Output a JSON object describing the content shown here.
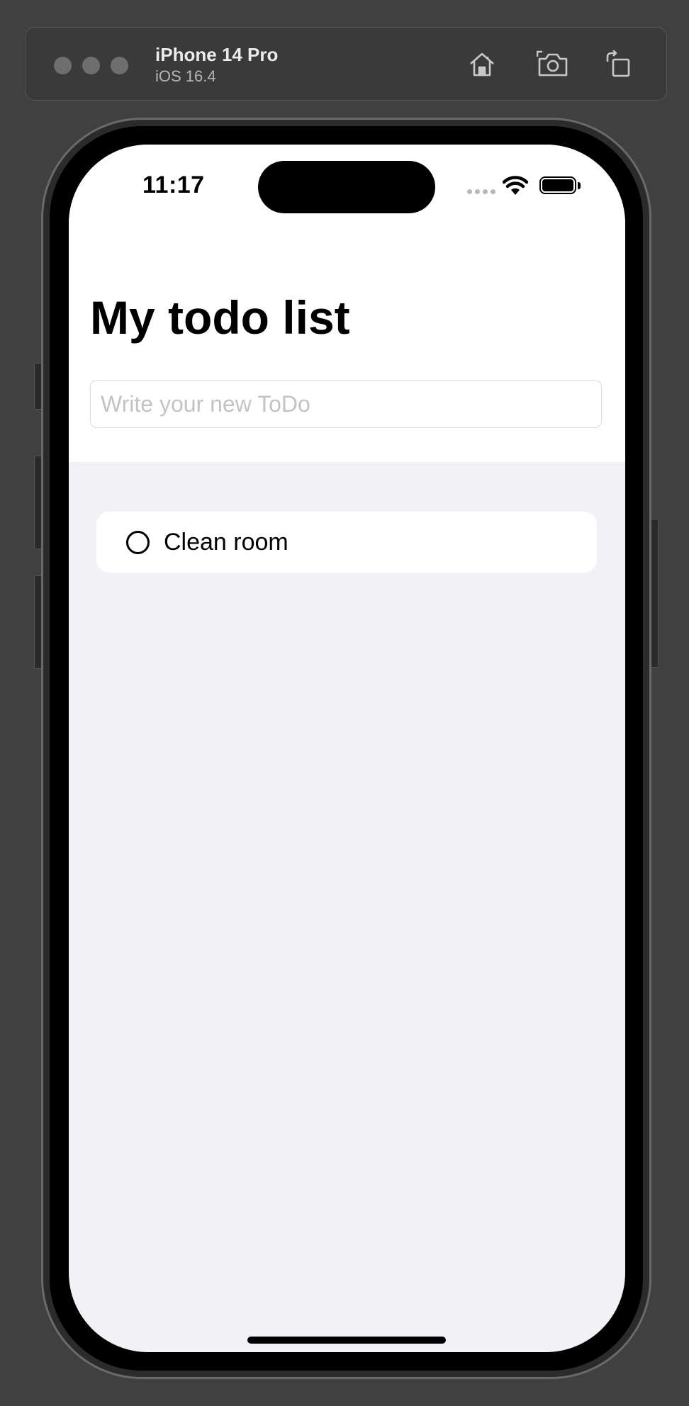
{
  "simulator": {
    "device_name": "iPhone 14 Pro",
    "os_version": "iOS 16.4",
    "toolbar_icons": [
      "home-icon",
      "screenshot-icon",
      "rotate-icon"
    ]
  },
  "status_bar": {
    "time": "11:17",
    "icons": [
      "cellular-signal-icon",
      "wifi-icon",
      "battery-icon"
    ]
  },
  "app": {
    "title": "My todo list",
    "new_todo_input": {
      "value": "",
      "placeholder": "Write your new ToDo"
    },
    "todos": [
      {
        "text": "Clean room",
        "completed": false
      }
    ]
  },
  "colors": {
    "screen_background": "#f1f1f6",
    "header_background": "#ffffff",
    "placeholder_text": "#c3c3c7"
  }
}
